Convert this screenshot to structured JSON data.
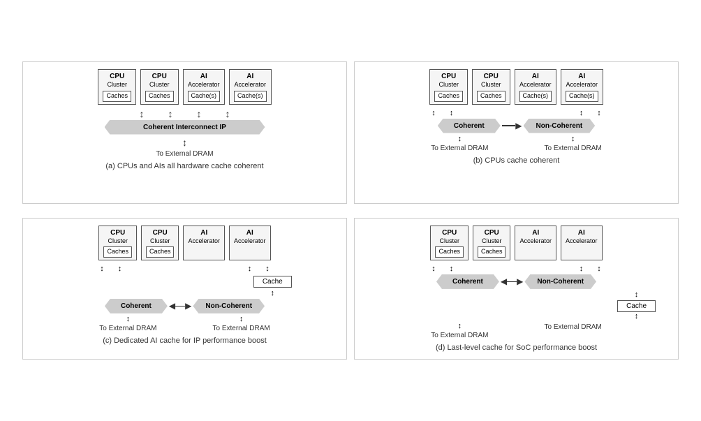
{
  "diagrams": [
    {
      "id": "a",
      "caption": "(a) CPUs and AIs all hardware cache coherent",
      "blocks": [
        {
          "title": "CPU",
          "sub": "Cluster",
          "inner": "Caches"
        },
        {
          "title": "CPU",
          "sub": "Cluster",
          "inner": "Caches"
        },
        {
          "title": "AI",
          "sub": "Accelerator",
          "inner": "Cache(s)"
        },
        {
          "title": "AI",
          "sub": "Accelerator",
          "inner": "Cache(s)"
        }
      ],
      "interconnect": "Coherent Interconnect IP",
      "type": "single",
      "dram": [
        "To External DRAM"
      ]
    },
    {
      "id": "b",
      "caption": "(b) CPUs cache coherent",
      "blocksLeft": [
        {
          "title": "CPU",
          "sub": "Cluster",
          "inner": "Caches"
        },
        {
          "title": "CPU",
          "sub": "Cluster",
          "inner": "Caches"
        }
      ],
      "blocksRight": [
        {
          "title": "AI",
          "sub": "Accelerator",
          "inner": "Cache(s)"
        },
        {
          "title": "AI",
          "sub": "Accelerator",
          "inner": "Cache(s)"
        }
      ],
      "bannerLeft": "Coherent",
      "bannerRight": "Non-Coherent",
      "type": "dual",
      "dram": [
        "To External DRAM",
        "To External DRAM"
      ]
    },
    {
      "id": "c",
      "caption": "(c) Dedicated AI cache for IP performance boost",
      "blocksLeft": [
        {
          "title": "CPU",
          "sub": "Cluster",
          "inner": "Caches"
        },
        {
          "title": "CPU",
          "sub": "Cluster",
          "inner": "Caches"
        }
      ],
      "blocksRight": [
        {
          "title": "AI",
          "sub": "Accelerator",
          "inner": null
        },
        {
          "title": "AI",
          "sub": "Accelerator",
          "inner": null
        }
      ],
      "middleCache": "Cache",
      "bannerLeft": "Coherent",
      "bannerRight": "Non-Coherent",
      "type": "dual-cache",
      "dram": [
        "To External DRAM",
        "To External DRAM"
      ]
    },
    {
      "id": "d",
      "caption": "(d) Last-level cache for SoC performance boost",
      "blocksLeft": [
        {
          "title": "CPU",
          "sub": "Cluster",
          "inner": "Caches"
        },
        {
          "title": "CPU",
          "sub": "Cluster",
          "inner": "Caches"
        }
      ],
      "blocksRight": [
        {
          "title": "AI",
          "sub": "Accelerator",
          "inner": null
        },
        {
          "title": "AI",
          "sub": "Accelerator",
          "inner": null
        }
      ],
      "middleCache": "Cache",
      "bannerLeft": "Coherent",
      "bannerRight": "Non-Coherent",
      "type": "dual-cache-below",
      "dram": [
        "To External DRAM",
        "To External DRAM"
      ]
    }
  ]
}
